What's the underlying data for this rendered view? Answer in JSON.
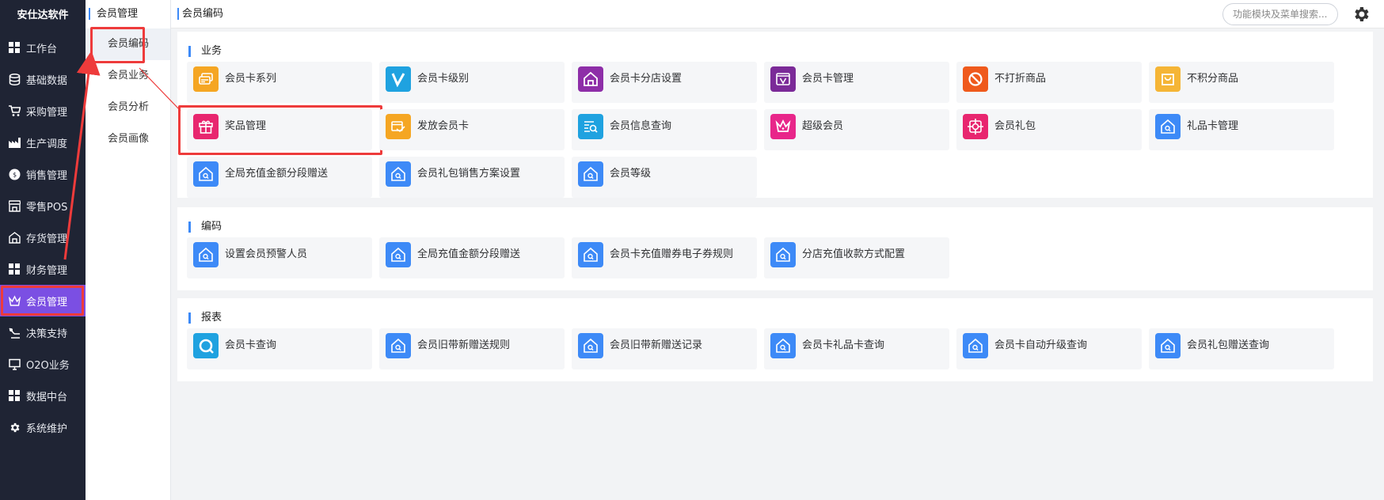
{
  "brand": "安仕达软件",
  "nav": [
    {
      "label": "工作台",
      "icon": "grid-icon"
    },
    {
      "label": "基础数据",
      "icon": "database-icon"
    },
    {
      "label": "采购管理",
      "icon": "cart-icon"
    },
    {
      "label": "生产调度",
      "icon": "factory-icon"
    },
    {
      "label": "销售管理",
      "icon": "sales-badge-icon"
    },
    {
      "label": "零售POS",
      "icon": "store-icon"
    },
    {
      "label": "存货管理",
      "icon": "warehouse-icon"
    },
    {
      "label": "财务管理",
      "icon": "grid-icon"
    },
    {
      "label": "会员管理",
      "icon": "crown-icon",
      "active": true
    },
    {
      "label": "决策支持",
      "icon": "decision-icon"
    },
    {
      "label": "O2O业务",
      "icon": "monitor-icon"
    },
    {
      "label": "数据中台",
      "icon": "grid-icon"
    },
    {
      "label": "系统维护",
      "icon": "gear-icon"
    }
  ],
  "submenu": {
    "title": "会员管理",
    "items": [
      {
        "label": "会员编码",
        "active": true
      },
      {
        "label": "会员业务"
      },
      {
        "label": "会员分析"
      },
      {
        "label": "会员画像"
      }
    ]
  },
  "header": {
    "breadcrumb": "会员编码",
    "search_placeholder": "功能模块及菜单搜索..."
  },
  "sections": [
    {
      "title": "业务",
      "cards": [
        {
          "label": "会员卡系列",
          "icon": "card-stack-icon",
          "color": "#f5a623"
        },
        {
          "label": "会员卡级别",
          "icon": "v-letter-icon",
          "color": "#1fa2e0"
        },
        {
          "label": "会员卡分店设置",
          "icon": "house-icon",
          "color": "#8e2ea8"
        },
        {
          "label": "会员卡管理",
          "icon": "v-card-icon",
          "color": "#7b2a98"
        },
        {
          "label": "不打折商品",
          "icon": "no-sign-icon",
          "color": "#ef5a1c"
        },
        {
          "label": "不积分商品",
          "icon": "bag-icon",
          "color": "#f5b536"
        },
        {
          "label": "奖品管理",
          "icon": "gift-icon",
          "color": "#e8266f",
          "highlight": true
        },
        {
          "label": "发放会员卡",
          "icon": "card-issue-icon",
          "color": "#f5a623"
        },
        {
          "label": "会员信息查询",
          "icon": "search-list-icon",
          "color": "#1fa2e0"
        },
        {
          "label": "超级会员",
          "icon": "crown-icon",
          "color": "#e8268a"
        },
        {
          "label": "会员礼包",
          "icon": "target-icon",
          "color": "#e8266f"
        },
        {
          "label": "礼品卡管理",
          "icon": "house-search-icon",
          "color": "#3d8af7"
        },
        {
          "label": "全局充值金额分段赠送",
          "icon": "house-search-icon",
          "color": "#3d8af7"
        },
        {
          "label": "会员礼包销售方案设置",
          "icon": "house-search-icon",
          "color": "#3d8af7"
        },
        {
          "label": "会员等级",
          "icon": "house-search-icon",
          "color": "#3d8af7"
        }
      ]
    },
    {
      "title": "编码",
      "cards": [
        {
          "label": "设置会员预警人员",
          "icon": "house-search-icon",
          "color": "#3d8af7"
        },
        {
          "label": "全局充值金额分段赠送",
          "icon": "house-search-icon",
          "color": "#3d8af7"
        },
        {
          "label": "会员卡充值赠券电子券规则",
          "icon": "house-search-icon",
          "color": "#3d8af7"
        },
        {
          "label": "分店充值收款方式配置",
          "icon": "house-search-icon",
          "color": "#3d8af7"
        }
      ]
    },
    {
      "title": "报表",
      "cards": [
        {
          "label": "会员卡查询",
          "icon": "magnifier-icon",
          "color": "#1fa2e0"
        },
        {
          "label": "会员旧带新赠送规则",
          "icon": "house-search-icon",
          "color": "#3d8af7"
        },
        {
          "label": "会员旧带新赠送记录",
          "icon": "house-search-icon",
          "color": "#3d8af7"
        },
        {
          "label": "会员卡礼品卡查询",
          "icon": "house-search-icon",
          "color": "#3d8af7"
        },
        {
          "label": "会员卡自动升级查询",
          "icon": "house-search-icon",
          "color": "#3d8af7"
        },
        {
          "label": "会员礼包赠送查询",
          "icon": "house-search-icon",
          "color": "#3d8af7"
        }
      ]
    }
  ],
  "colors": {
    "nav_bg": "#1f2434",
    "nav_active": "#7b4fe3",
    "accent": "#3d8af7",
    "annotation": "#ee3b3b"
  }
}
